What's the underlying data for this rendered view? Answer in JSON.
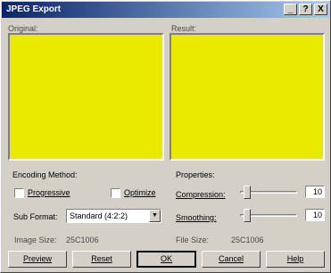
{
  "window": {
    "title": "JPEG Export",
    "controls": {
      "minimize": "_",
      "help": "?",
      "close": "X"
    }
  },
  "preview": {
    "original_label": "Original:",
    "result_label": "Result:",
    "fill_color": "#eaea00"
  },
  "encoding": {
    "heading": "Encoding Method:",
    "progressive_label": "Progressive",
    "progressive_checked": false,
    "optimize_label": "Optimize",
    "optimize_checked": false,
    "subformat_label": "Sub Format:",
    "subformat_value": "Standard (4:2:2)",
    "image_size_label": "Image Size:",
    "image_size_value": "25C1006"
  },
  "properties": {
    "heading": "Properties:",
    "compression_label": "Compression:",
    "compression_value": "10",
    "smoothing_label": "Smoothing:",
    "smoothing_value": "10",
    "file_size_label": "File Size:",
    "file_size_value": "25C1006"
  },
  "buttons": {
    "preview": "Preview",
    "reset": "Reset",
    "ok": "OK",
    "cancel": "Cancel",
    "help": "Help"
  }
}
